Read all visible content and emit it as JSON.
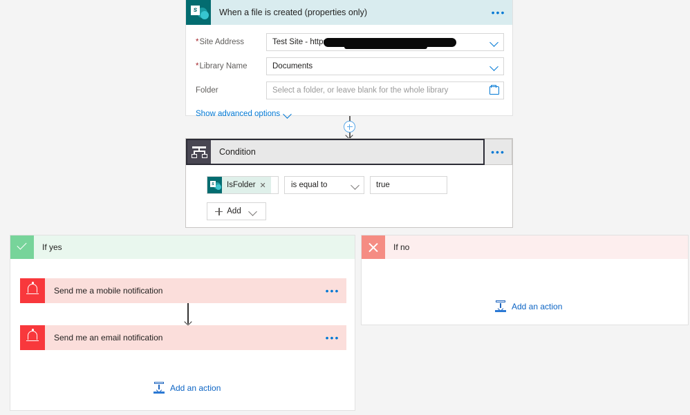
{
  "trigger": {
    "title": "When a file is created (properties only)",
    "icon": "sharepoint-icon",
    "icon_letter": "s",
    "menu": "•••",
    "fields": [
      {
        "label": "Site Address",
        "required": true,
        "value": "Test Site - https://",
        "redacted": true,
        "control": "dropdown"
      },
      {
        "label": "Library Name",
        "required": true,
        "value": "Documents",
        "redacted": false,
        "control": "dropdown"
      },
      {
        "label": "Folder",
        "required": false,
        "value": "",
        "placeholder": "Select a folder, or leave blank for the whole library",
        "redacted": false,
        "control": "folder-picker"
      }
    ],
    "advanced_options_label": "Show advanced options"
  },
  "connector": {
    "add_step_icon": "plus-circle-icon"
  },
  "condition": {
    "title": "Condition",
    "icon": "condition-branch-icon",
    "menu": "•••",
    "row": {
      "token_label": "IsFolder",
      "token_icon": "sharepoint-icon",
      "token_icon_letter": "s",
      "token_remove": "✕",
      "operator": "is equal to",
      "value": "true"
    },
    "add_label": "Add"
  },
  "branches": {
    "yes": {
      "label": "If yes",
      "badge_icon": "check-icon",
      "actions": [
        {
          "title": "Send me a mobile notification",
          "icon": "bell-icon",
          "menu": "•••"
        },
        {
          "title": "Send me an email notification",
          "icon": "bell-icon",
          "menu": "•••"
        }
      ],
      "add_action_label": "Add an action"
    },
    "no": {
      "label": "If no",
      "badge_icon": "close-x-icon",
      "actions": [],
      "add_action_label": "Add an action"
    }
  },
  "colors": {
    "sharepoint_teal": "#036c70",
    "trigger_header": "#d9ecef",
    "condition_icon": "#484652",
    "yes_badge": "#77d49a",
    "yes_header": "#e9f7ee",
    "no_badge": "#f58c83",
    "no_header": "#fdeeee",
    "notification_red": "#f8383c",
    "notification_card": "#fbdedb",
    "link_blue": "#0078d4",
    "required_star": "#a4262c",
    "canvas_bg": "#f4f4f4"
  }
}
